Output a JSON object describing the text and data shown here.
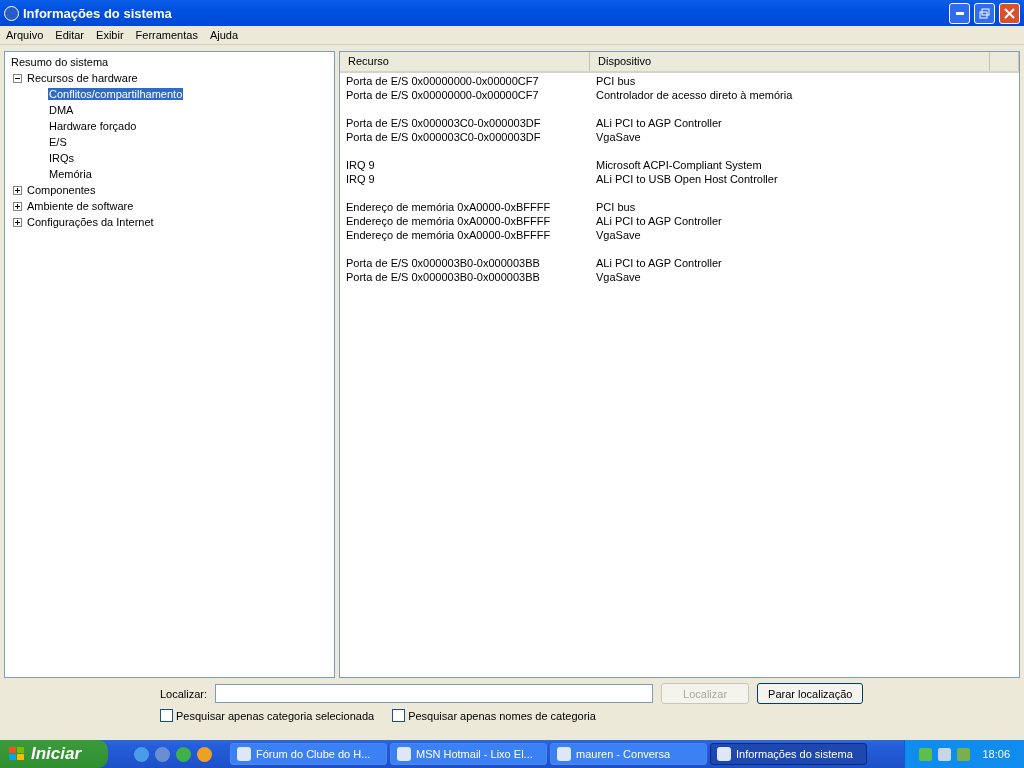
{
  "window": {
    "title": "Informações do sistema"
  },
  "menu": [
    "Arquivo",
    "Editar",
    "Exibir",
    "Ferramentas",
    "Ajuda"
  ],
  "tree": [
    {
      "label": "Resumo do sistema",
      "selected": false,
      "children": [
        {
          "label": "Recursos de hardware",
          "selected": false,
          "expanded": true,
          "children": [
            {
              "label": "Conflitos/compartilhamento",
              "selected": true
            },
            {
              "label": "DMA",
              "selected": false
            },
            {
              "label": "Hardware forçado",
              "selected": false
            },
            {
              "label": "E/S",
              "selected": false
            },
            {
              "label": "IRQs",
              "selected": false
            },
            {
              "label": "Memória",
              "selected": false
            }
          ]
        },
        {
          "label": "Componentes",
          "selected": false,
          "expanded": false
        },
        {
          "label": "Ambiente de software",
          "selected": false,
          "expanded": false
        },
        {
          "label": "Configurações da Internet",
          "selected": false,
          "expanded": false
        }
      ]
    }
  ],
  "table": {
    "columns": [
      "Recurso",
      "Dispositivo"
    ],
    "groups": [
      [
        {
          "resource": "Porta de E/S 0x00000000-0x00000CF7",
          "device": "PCI bus"
        },
        {
          "resource": "Porta de E/S 0x00000000-0x00000CF7",
          "device": "Controlador de acesso direto à memória"
        }
      ],
      [
        {
          "resource": "Porta de E/S 0x000003C0-0x000003DF",
          "device": "ALi PCI to AGP Controller"
        },
        {
          "resource": "Porta de E/S 0x000003C0-0x000003DF",
          "device": "VgaSave"
        }
      ],
      [
        {
          "resource": "IRQ 9",
          "device": "Microsoft ACPI-Compliant System"
        },
        {
          "resource": "IRQ 9",
          "device": "ALi PCI to USB Open Host Controller"
        }
      ],
      [
        {
          "resource": "Endereço de memória 0xA0000-0xBFFFF",
          "device": "PCI bus"
        },
        {
          "resource": "Endereço de memória 0xA0000-0xBFFFF",
          "device": "ALi PCI to AGP Controller"
        },
        {
          "resource": "Endereço de memória 0xA0000-0xBFFFF",
          "device": "VgaSave"
        }
      ],
      [
        {
          "resource": "Porta de E/S 0x000003B0-0x000003BB",
          "device": "ALi PCI to AGP Controller"
        },
        {
          "resource": "Porta de E/S 0x000003B0-0x000003BB",
          "device": "VgaSave"
        }
      ]
    ]
  },
  "find": {
    "label": "Localizar:",
    "buttons": [
      {
        "label": "Localizar",
        "disabled": true
      },
      {
        "label": "Parar localização",
        "disabled": false
      }
    ],
    "checkboxes": [
      {
        "label": "Pesquisar apenas categoria selecionada",
        "checked": false
      },
      {
        "label": "Pesquisar apenas nomes de categoria",
        "checked": false
      }
    ]
  },
  "taskbar": {
    "start": "Iniciar",
    "tasks": [
      {
        "label": "Fórum do Clube do H...",
        "selected": false
      },
      {
        "label": "MSN Hotmail - Lixo El...",
        "selected": false
      },
      {
        "label": "mauren - Conversa",
        "selected": false
      },
      {
        "label": "Informações do sistema",
        "selected": true
      }
    ],
    "clock": "18:06"
  }
}
